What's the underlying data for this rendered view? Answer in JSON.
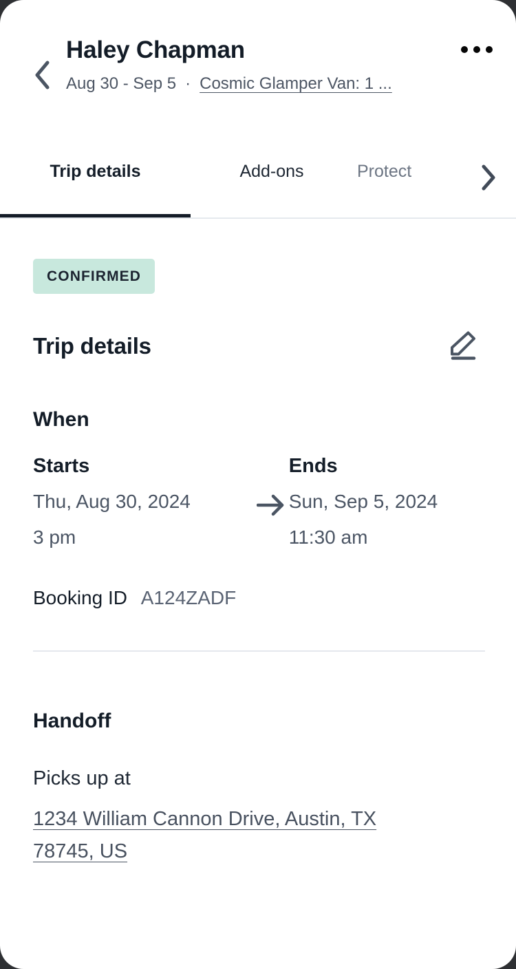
{
  "header": {
    "back_icon": "chevron-left-icon",
    "guest_name": "Haley Chapman",
    "date_range": "Aug 30 - Sep 5",
    "separator": "·",
    "vehicle_link": "Cosmic Glamper Van: 1 ...",
    "more_icon": "kebab-menu-icon"
  },
  "tabs": {
    "items": [
      {
        "label": "Trip details",
        "active": true
      },
      {
        "label": "Add-ons",
        "active": false
      },
      {
        "label": "Protect",
        "active": false
      }
    ],
    "next_icon": "chevron-right-icon"
  },
  "main": {
    "status_badge": "CONFIRMED",
    "section_title": "Trip details",
    "edit_icon": "pencil-edit-icon",
    "when": {
      "heading": "When",
      "arrow_icon": "arrow-right-icon",
      "starts": {
        "label": "Starts",
        "date": "Thu, Aug 30, 2024",
        "time": "3 pm"
      },
      "ends": {
        "label": "Ends",
        "date": "Sun, Sep 5, 2024",
        "time": "11:30 am"
      }
    },
    "booking": {
      "label": "Booking ID",
      "value": "A124ZADF"
    },
    "handoff": {
      "heading": "Handoff",
      "pickup_label": "Picks up at",
      "pickup_address": "1234 William Cannon Drive, Austin, TX 78745, US"
    }
  },
  "colors": {
    "badge_bg": "#c8e8dd",
    "text_dark": "#131c27",
    "text_muted": "#4b5564",
    "divider": "#e4e8ed",
    "tab_active_underline": "#141d28"
  }
}
